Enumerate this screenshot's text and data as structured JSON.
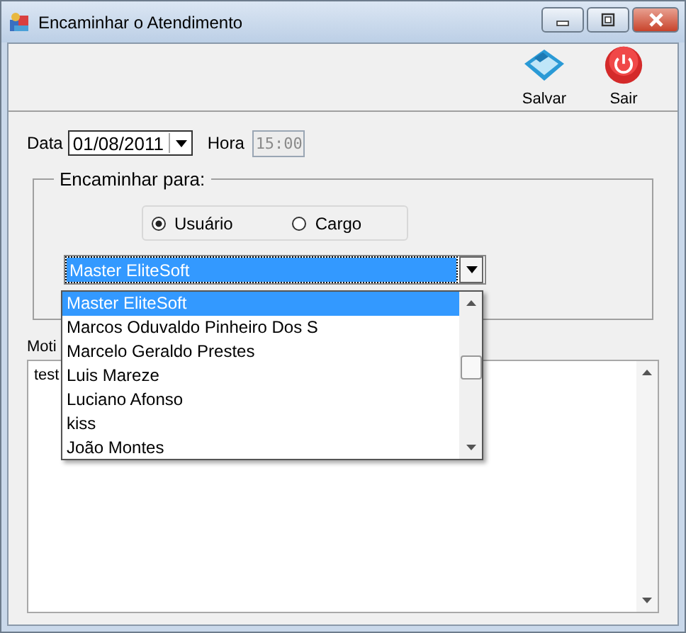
{
  "window": {
    "title": "Encaminhar o Atendimento"
  },
  "toolbar": [
    {
      "kind": "save",
      "label": "Salvar"
    },
    {
      "kind": "exit",
      "label": "Sair"
    }
  ],
  "data": {
    "label": "Data",
    "value": "01/08/2011"
  },
  "hora": {
    "label": "Hora",
    "value": "15:00",
    "disabled": true
  },
  "group": {
    "legend": "Encaminhar para:",
    "options": [
      {
        "label": "Usuário",
        "selected": true
      },
      {
        "label": "Cargo",
        "selected": false
      }
    ]
  },
  "combo": {
    "value": "Master EliteSoft",
    "expanded": true,
    "items": [
      {
        "label": "Master EliteSoft",
        "selected": true
      },
      {
        "label": "Marcos Oduvaldo Pinheiro Dos S",
        "selected": false
      },
      {
        "label": "Marcelo Geraldo Prestes",
        "selected": false
      },
      {
        "label": "Luis Mareze",
        "selected": false
      },
      {
        "label": "Luciano Afonso",
        "selected": false
      },
      {
        "label": "kiss",
        "selected": false
      },
      {
        "label": "João Montes",
        "selected": false
      }
    ]
  },
  "motivo": {
    "label": "Moti",
    "value": "test"
  }
}
